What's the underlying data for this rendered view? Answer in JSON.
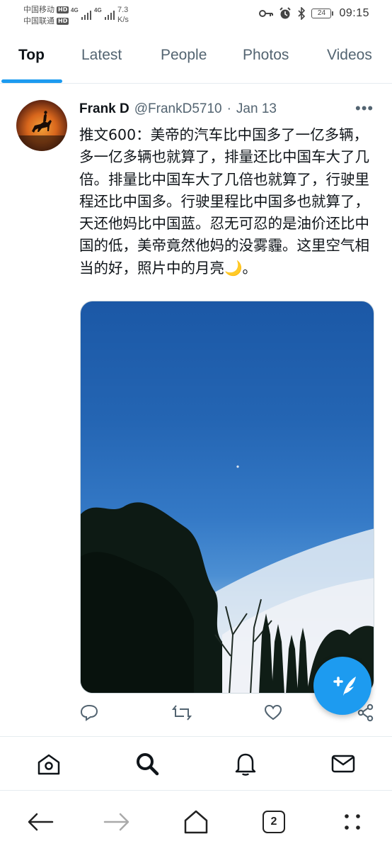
{
  "status_bar": {
    "carrier1": "中国移动",
    "carrier2": "中国联通",
    "hd_label": "HD",
    "network_label": "4G",
    "speed_value": "7.3",
    "speed_unit": "K/s",
    "battery": "24",
    "time": "09:15"
  },
  "tabs": [
    {
      "label": "Top",
      "active": true
    },
    {
      "label": "Latest",
      "active": false
    },
    {
      "label": "People",
      "active": false
    },
    {
      "label": "Photos",
      "active": false
    },
    {
      "label": "Videos",
      "active": false
    }
  ],
  "tweet": {
    "name": "Frank D",
    "handle": "@FrankD5710",
    "separator": "·",
    "date": "Jan 13",
    "text": "推文600：美帝的汽车比中国多了一亿多辆， 多一亿多辆也就算了，排量还比中国车大了几倍。排量比中国车大了几倍也就算了，行驶里程还比中国多。行驶里程比中国多也就算了，天还他妈比中国蓝。忍无可忍的是油价还比中国的低，美帝竟然他妈的没雾霾。这里空气相当的好，照片中的月亮🌙。"
  },
  "tab_count": "2",
  "colors": {
    "accent": "#1d9bf0",
    "text": "#0f1419",
    "muted": "#536471"
  },
  "icons": {
    "status": [
      "key-icon",
      "alarm-icon",
      "bluetooth-icon",
      "battery-icon"
    ],
    "actions": [
      "reply-icon",
      "retweet-icon",
      "like-icon",
      "share-icon"
    ],
    "nav": [
      "home-icon",
      "search-icon",
      "notifications-icon",
      "messages-icon"
    ],
    "system": [
      "back-icon",
      "forward-icon",
      "home-icon",
      "tabs-icon",
      "menu-icon"
    ]
  }
}
